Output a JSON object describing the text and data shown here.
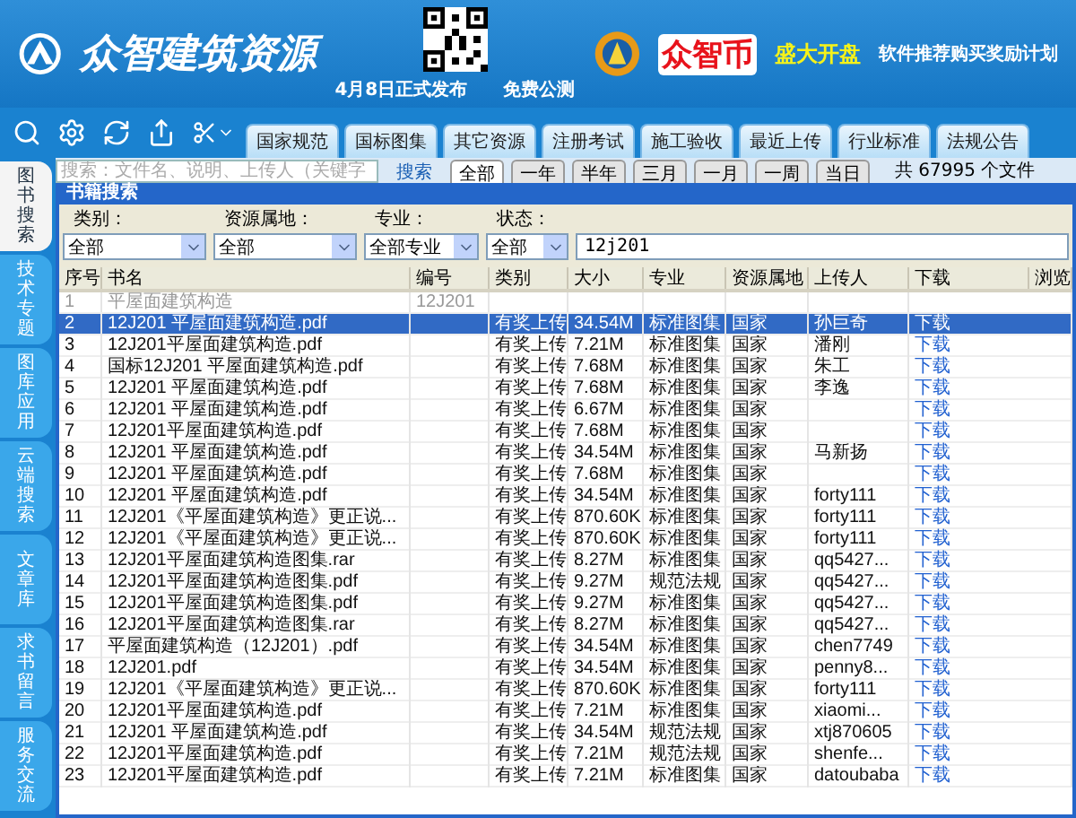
{
  "header": {
    "title": "众智建筑资源",
    "release": "4月8日正式发布",
    "beta": "免费公测",
    "coin_name": "众智币",
    "coin_slogan": "盛大开盘",
    "promo": "软件推荐购买奖励计划"
  },
  "category_tabs": [
    {
      "label": "国家规范",
      "selected": false
    },
    {
      "label": "国标图集",
      "selected": false
    },
    {
      "label": "其它资源",
      "selected": false
    },
    {
      "label": "注册考试",
      "selected": false
    },
    {
      "label": "施工验收",
      "selected": false
    },
    {
      "label": "最近上传",
      "selected": false
    },
    {
      "label": "行业标准",
      "selected": false
    },
    {
      "label": "法规公告",
      "selected": false
    }
  ],
  "search": {
    "placeholder": "搜索：文件名、说明、上传人（关键字",
    "button": "搜索"
  },
  "time_tabs": [
    {
      "label": "全部",
      "selected": true
    },
    {
      "label": "一年",
      "selected": false
    },
    {
      "label": "半年",
      "selected": false
    },
    {
      "label": "三月",
      "selected": false
    },
    {
      "label": "一月",
      "selected": false
    },
    {
      "label": "一周",
      "selected": false
    },
    {
      "label": "当日",
      "selected": false
    }
  ],
  "file_count": "共 67995 个文件",
  "side_tabs": [
    {
      "label": "图书搜索",
      "selected": true
    },
    {
      "label": "技术专题",
      "selected": false
    },
    {
      "label": "图库应用",
      "selected": false
    },
    {
      "label": "云端搜索",
      "selected": false
    },
    {
      "label": "文章库",
      "selected": false
    },
    {
      "label": "求书留言",
      "selected": false
    },
    {
      "label": "服务交流",
      "selected": false
    }
  ],
  "panel_title": "书籍搜索",
  "filters": [
    {
      "label": "类别：",
      "value": "全部"
    },
    {
      "label": "资源属地：",
      "value": "全部"
    },
    {
      "label": "专业：",
      "value": "全部专业"
    },
    {
      "label": "状态：",
      "value": "全部"
    }
  ],
  "keyword": "12j201",
  "table": {
    "columns": [
      "序号",
      "书名",
      "编号",
      "类别",
      "大小",
      "专业",
      "资源属地",
      "上传人",
      "下载",
      "浏览"
    ],
    "rows": [
      {
        "cells": [
          "1",
          "平屋面建筑构造",
          "12J201",
          "",
          "",
          "",
          "",
          "",
          ""
        ],
        "disabled": true,
        "selected": false
      },
      {
        "cells": [
          "2",
          "12J201 平屋面建筑构造.pdf",
          "",
          "有奖上传",
          "34.54M",
          "标准图集",
          "国家",
          "孙巨奇",
          "下载"
        ],
        "disabled": false,
        "selected": true
      },
      {
        "cells": [
          "3",
          "12J201平屋面建筑构造.pdf",
          "",
          "有奖上传",
          "7.21M",
          "标准图集",
          "国家",
          "潘刚",
          "下载"
        ],
        "disabled": false,
        "selected": false
      },
      {
        "cells": [
          "4",
          "国标12J201 平屋面建筑构造.pdf",
          "",
          "有奖上传",
          "7.68M",
          "标准图集",
          "国家",
          "朱工",
          "下载"
        ],
        "disabled": false,
        "selected": false
      },
      {
        "cells": [
          "5",
          "12J201 平屋面建筑构造.pdf",
          "",
          "有奖上传",
          "7.68M",
          "标准图集",
          "国家",
          "李逸",
          "下载"
        ],
        "disabled": false,
        "selected": false
      },
      {
        "cells": [
          "6",
          "12J201 平屋面建筑构造.pdf",
          "",
          "有奖上传",
          "6.67M",
          "标准图集",
          "国家",
          "",
          "下载"
        ],
        "disabled": false,
        "selected": false
      },
      {
        "cells": [
          "7",
          "12J201平屋面建筑构造.pdf",
          "",
          "有奖上传",
          "7.68M",
          "标准图集",
          "国家",
          "",
          "下载"
        ],
        "disabled": false,
        "selected": false
      },
      {
        "cells": [
          "8",
          "12J201 平屋面建筑构造.pdf",
          "",
          "有奖上传",
          "34.54M",
          "标准图集",
          "国家",
          "马新扬",
          "下载"
        ],
        "disabled": false,
        "selected": false
      },
      {
        "cells": [
          "9",
          "12J201 平屋面建筑构造.pdf",
          "",
          "有奖上传",
          "7.68M",
          "标准图集",
          "国家",
          "",
          "下载"
        ],
        "disabled": false,
        "selected": false
      },
      {
        "cells": [
          "10",
          "12J201 平屋面建筑构造.pdf",
          "",
          "有奖上传",
          "34.54M",
          "标准图集",
          "国家",
          "forty111",
          "下载"
        ],
        "disabled": false,
        "selected": false
      },
      {
        "cells": [
          "11",
          "12J201《平屋面建筑构造》更正说...",
          "",
          "有奖上传",
          "870.60K",
          "标准图集",
          "国家",
          "forty111",
          "下载"
        ],
        "disabled": false,
        "selected": false
      },
      {
        "cells": [
          "12",
          "12J201《平屋面建筑构造》更正说...",
          "",
          "有奖上传",
          "870.60K",
          "标准图集",
          "国家",
          "forty111",
          "下载"
        ],
        "disabled": false,
        "selected": false
      },
      {
        "cells": [
          "13",
          "12J201平屋面建筑构造图集.rar",
          "",
          "有奖上传",
          "8.27M",
          "标准图集",
          "国家",
          "qq5427...",
          "下载"
        ],
        "disabled": false,
        "selected": false
      },
      {
        "cells": [
          "14",
          "12J201平屋面建筑构造图集.pdf",
          "",
          "有奖上传",
          "9.27M",
          "规范法规",
          "国家",
          "qq5427...",
          "下载"
        ],
        "disabled": false,
        "selected": false
      },
      {
        "cells": [
          "15",
          "12J201平屋面建筑构造图集.pdf",
          "",
          "有奖上传",
          "9.27M",
          "标准图集",
          "国家",
          "qq5427...",
          "下载"
        ],
        "disabled": false,
        "selected": false
      },
      {
        "cells": [
          "16",
          "12J201平屋面建筑构造图集.rar",
          "",
          "有奖上传",
          "8.27M",
          "标准图集",
          "国家",
          "qq5427...",
          "下载"
        ],
        "disabled": false,
        "selected": false
      },
      {
        "cells": [
          "17",
          "平屋面建筑构造（12J201）.pdf",
          "",
          "有奖上传",
          "34.54M",
          "标准图集",
          "国家",
          "chen7749",
          "下载"
        ],
        "disabled": false,
        "selected": false
      },
      {
        "cells": [
          "18",
          "12J201.pdf",
          "",
          "有奖上传",
          "34.54M",
          "标准图集",
          "国家",
          "penny8...",
          "下载"
        ],
        "disabled": false,
        "selected": false
      },
      {
        "cells": [
          "19",
          "12J201《平屋面建筑构造》更正说...",
          "",
          "有奖上传",
          "870.60K",
          "标准图集",
          "国家",
          "forty111",
          "下载"
        ],
        "disabled": false,
        "selected": false
      },
      {
        "cells": [
          "20",
          "12J201平屋面建筑构造.pdf",
          "",
          "有奖上传",
          "7.21M",
          "标准图集",
          "国家",
          "xiaomi...",
          "下载"
        ],
        "disabled": false,
        "selected": false
      },
      {
        "cells": [
          "21",
          "12J201 平屋面建筑构造.pdf",
          "",
          "有奖上传",
          "34.54M",
          "规范法规",
          "国家",
          "xtj870605",
          "下载"
        ],
        "disabled": false,
        "selected": false
      },
      {
        "cells": [
          "22",
          "12J201平屋面建筑构造.pdf",
          "",
          "有奖上传",
          "7.21M",
          "规范法规",
          "国家",
          "shenfe...",
          "下载"
        ],
        "disabled": false,
        "selected": false
      },
      {
        "cells": [
          "23",
          "12J201平屋面建筑构造.pdf",
          "",
          "有奖上传",
          "7.21M",
          "标准图集",
          "国家",
          "datoubaba",
          "下载"
        ],
        "disabled": false,
        "selected": false
      }
    ]
  }
}
